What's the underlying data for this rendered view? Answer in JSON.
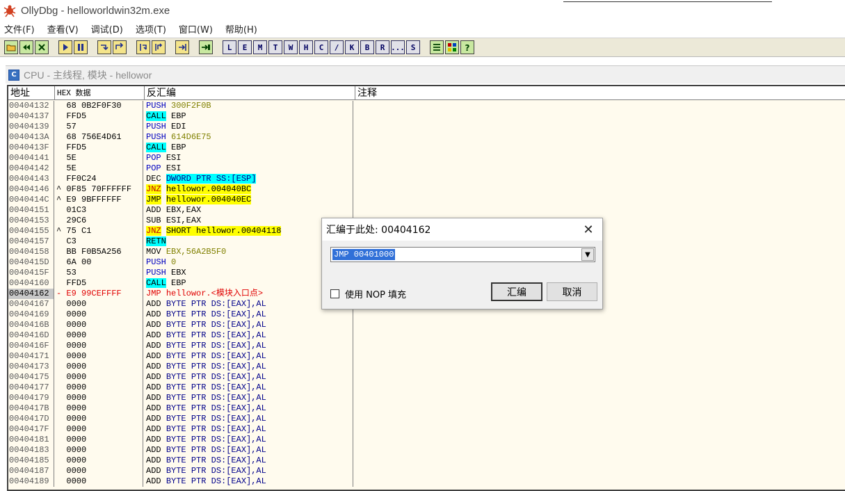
{
  "window": {
    "title": "OllyDbg - helloworldwin32m.exe"
  },
  "menu": [
    "文件(F)",
    "查看(V)",
    "调试(D)",
    "选项(T)",
    "窗口(W)",
    "帮助(H)"
  ],
  "toolbar": {
    "letters": [
      "L",
      "E",
      "M",
      "T",
      "W",
      "H",
      "C",
      "/",
      "K",
      "B",
      "R",
      "...",
      "S"
    ]
  },
  "cpu": {
    "title": "CPU - 主线程, 模块 - hellowor",
    "headers": {
      "addr": "地址",
      "hex": "HEX 数据",
      "dis": "反汇编",
      "cmt": "注释"
    },
    "rows": [
      {
        "addr": "00404132",
        "hex": "  68 0B2F0F30",
        "mn": "PUSH",
        "mc": "m-push",
        "arg": "300F2F0B",
        "ac": "a-const"
      },
      {
        "addr": "00404137",
        "hex": "  FFD5",
        "mn": "CALL",
        "mc": "m-call",
        "arg": "EBP",
        "ac": ""
      },
      {
        "addr": "00404139",
        "hex": "  57",
        "mn": "PUSH",
        "mc": "m-push",
        "arg": "EDI",
        "ac": ""
      },
      {
        "addr": "0040413A",
        "hex": "  68 756E4D61",
        "mn": "PUSH",
        "mc": "m-push",
        "arg": "614D6E75",
        "ac": "a-const"
      },
      {
        "addr": "0040413F",
        "hex": "  FFD5",
        "mn": "CALL",
        "mc": "m-call",
        "arg": "EBP",
        "ac": ""
      },
      {
        "addr": "00404141",
        "hex": "  5E",
        "mn": "POP",
        "mc": "m-push",
        "arg": "ESI",
        "ac": ""
      },
      {
        "addr": "00404142",
        "hex": "  5E",
        "mn": "POP",
        "mc": "m-push",
        "arg": "ESI",
        "ac": ""
      },
      {
        "addr": "00404143",
        "hex": "  FF0C24",
        "mn": "DEC",
        "mc": "",
        "arg": "DWORD PTR SS:[ESP]",
        "ac": "a-memhi"
      },
      {
        "addr": "00404146",
        "hex": "^ 0F85 70FFFFFF",
        "mn": "JNZ",
        "mc": "m-jcc",
        "arg": "hellowor.004040BC",
        "ac": "a-jtarget"
      },
      {
        "addr": "0040414C",
        "hex": "^ E9 9BFFFFFF",
        "mn": "JMP",
        "mc": "m-jmp",
        "arg": "hellowor.004040EC",
        "ac": "a-jtarget"
      },
      {
        "addr": "00404151",
        "hex": "  01C3",
        "mn": "ADD",
        "mc": "",
        "arg": "EBX,EAX",
        "ac": ""
      },
      {
        "addr": "00404153",
        "hex": "  29C6",
        "mn": "SUB",
        "mc": "",
        "arg": "ESI,EAX",
        "ac": ""
      },
      {
        "addr": "00404155",
        "hex": "^ 75 C1",
        "mn": "JNZ",
        "mc": "m-jcc",
        "arg": "SHORT hellowor.00404118",
        "ac": "a-jtarget"
      },
      {
        "addr": "00404157",
        "hex": "  C3",
        "mn": "RETN",
        "mc": "m-retn",
        "arg": "",
        "ac": ""
      },
      {
        "addr": "00404158",
        "hex": "  BB F0B5A256",
        "mn": "MOV",
        "mc": "",
        "arg": "EBX,56A2B5F0",
        "ac": "a-const"
      },
      {
        "addr": "0040415D",
        "hex": "  6A 00",
        "mn": "PUSH",
        "mc": "m-push",
        "arg": "0",
        "ac": "a-const"
      },
      {
        "addr": "0040415F",
        "hex": "  53",
        "mn": "PUSH",
        "mc": "m-push",
        "arg": "EBX",
        "ac": ""
      },
      {
        "addr": "00404160",
        "hex": "  FFD5",
        "mn": "CALL",
        "mc": "m-call",
        "arg": "EBP",
        "ac": ""
      },
      {
        "addr": "00404162",
        "hex": "- E9 99CEFFFF",
        "mn": "JMP",
        "mc": "",
        "arg": "hellowor.<模块入口点>",
        "ac": "",
        "sel": true
      },
      {
        "addr": "00404167",
        "hex": "  0000",
        "mn": "ADD",
        "mc": "",
        "arg": "BYTE PTR DS:[EAX],AL",
        "ac": "a-mem"
      },
      {
        "addr": "00404169",
        "hex": "  0000",
        "mn": "ADD",
        "mc": "",
        "arg": "BYTE PTR DS:[EAX],AL",
        "ac": "a-mem"
      },
      {
        "addr": "0040416B",
        "hex": "  0000",
        "mn": "ADD",
        "mc": "",
        "arg": "BYTE PTR DS:[EAX],AL",
        "ac": "a-mem"
      },
      {
        "addr": "0040416D",
        "hex": "  0000",
        "mn": "ADD",
        "mc": "",
        "arg": "BYTE PTR DS:[EAX],AL",
        "ac": "a-mem"
      },
      {
        "addr": "0040416F",
        "hex": "  0000",
        "mn": "ADD",
        "mc": "",
        "arg": "BYTE PTR DS:[EAX],AL",
        "ac": "a-mem"
      },
      {
        "addr": "00404171",
        "hex": "  0000",
        "mn": "ADD",
        "mc": "",
        "arg": "BYTE PTR DS:[EAX],AL",
        "ac": "a-mem"
      },
      {
        "addr": "00404173",
        "hex": "  0000",
        "mn": "ADD",
        "mc": "",
        "arg": "BYTE PTR DS:[EAX],AL",
        "ac": "a-mem"
      },
      {
        "addr": "00404175",
        "hex": "  0000",
        "mn": "ADD",
        "mc": "",
        "arg": "BYTE PTR DS:[EAX],AL",
        "ac": "a-mem"
      },
      {
        "addr": "00404177",
        "hex": "  0000",
        "mn": "ADD",
        "mc": "",
        "arg": "BYTE PTR DS:[EAX],AL",
        "ac": "a-mem"
      },
      {
        "addr": "00404179",
        "hex": "  0000",
        "mn": "ADD",
        "mc": "",
        "arg": "BYTE PTR DS:[EAX],AL",
        "ac": "a-mem"
      },
      {
        "addr": "0040417B",
        "hex": "  0000",
        "mn": "ADD",
        "mc": "",
        "arg": "BYTE PTR DS:[EAX],AL",
        "ac": "a-mem"
      },
      {
        "addr": "0040417D",
        "hex": "  0000",
        "mn": "ADD",
        "mc": "",
        "arg": "BYTE PTR DS:[EAX],AL",
        "ac": "a-mem"
      },
      {
        "addr": "0040417F",
        "hex": "  0000",
        "mn": "ADD",
        "mc": "",
        "arg": "BYTE PTR DS:[EAX],AL",
        "ac": "a-mem"
      },
      {
        "addr": "00404181",
        "hex": "  0000",
        "mn": "ADD",
        "mc": "",
        "arg": "BYTE PTR DS:[EAX],AL",
        "ac": "a-mem"
      },
      {
        "addr": "00404183",
        "hex": "  0000",
        "mn": "ADD",
        "mc": "",
        "arg": "BYTE PTR DS:[EAX],AL",
        "ac": "a-mem"
      },
      {
        "addr": "00404185",
        "hex": "  0000",
        "mn": "ADD",
        "mc": "",
        "arg": "BYTE PTR DS:[EAX],AL",
        "ac": "a-mem"
      },
      {
        "addr": "00404187",
        "hex": "  0000",
        "mn": "ADD",
        "mc": "",
        "arg": "BYTE PTR DS:[EAX],AL",
        "ac": "a-mem"
      },
      {
        "addr": "00404189",
        "hex": "  0000",
        "mn": "ADD",
        "mc": "",
        "arg": "BYTE PTR DS:[EAX],AL",
        "ac": "a-mem"
      }
    ]
  },
  "dialog": {
    "title": "汇编于此处: 00404162",
    "close": "✕",
    "input_value": "JMP 00401000",
    "dropdown_arrow": "▼",
    "checkbox_label": "使用 NOP 填充",
    "checkbox_checked": false,
    "ok_label": "汇编",
    "cancel_label": "取消"
  }
}
